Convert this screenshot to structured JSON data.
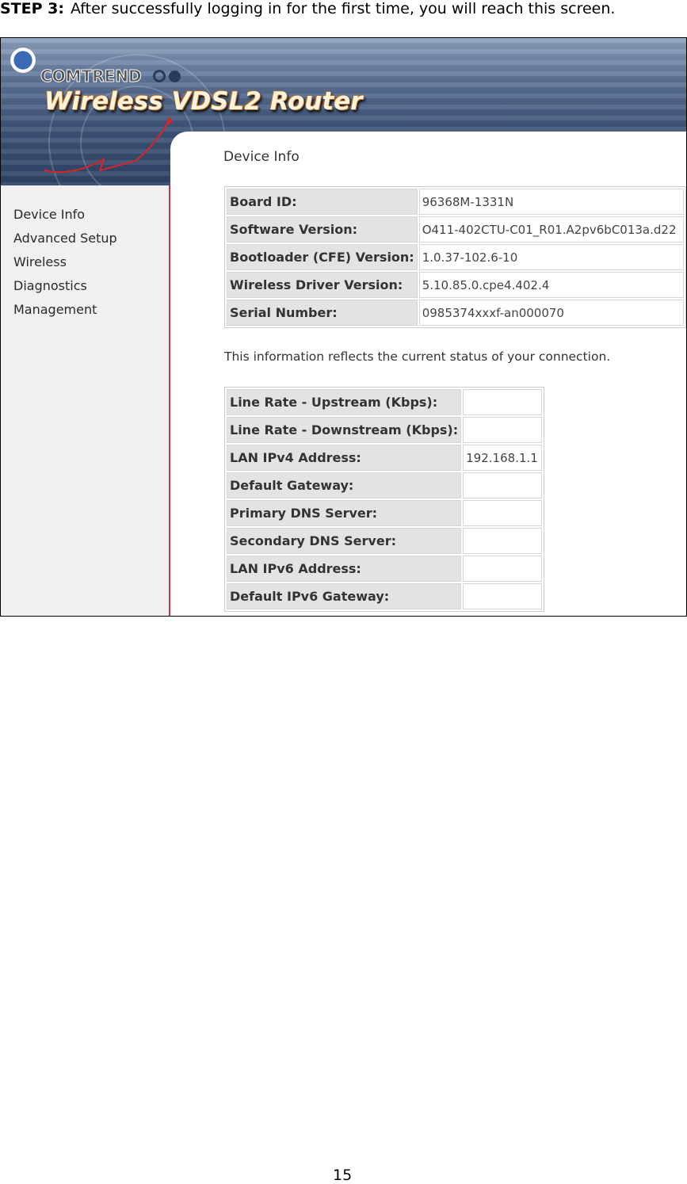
{
  "step": {
    "label": "STEP 3:",
    "text": "After successfully logging in for the first time, you will reach this screen."
  },
  "banner": {
    "brand": "COMTREND",
    "product": "Wireless VDSL2 Router"
  },
  "sidebar": {
    "items": [
      {
        "label": "Device Info"
      },
      {
        "label": "Advanced Setup"
      },
      {
        "label": "Wireless"
      },
      {
        "label": "Diagnostics"
      },
      {
        "label": "Management"
      }
    ]
  },
  "main": {
    "title": "Device Info",
    "info_table": [
      {
        "label": "Board ID:",
        "value": "96368M-1331N"
      },
      {
        "label": "Software Version:",
        "value": "O411-402CTU-C01_R01.A2pv6bC013a.d22"
      },
      {
        "label": "Bootloader (CFE) Version:",
        "value": "1.0.37-102.6-10"
      },
      {
        "label": "Wireless Driver Version:",
        "value": "5.10.85.0.cpe4.402.4"
      },
      {
        "label": "Serial Number:",
        "value": "0985374xxxf-an000070"
      }
    ],
    "note": "This information reflects the current status of your connection.",
    "status_table": [
      {
        "label": "Line Rate - Upstream (Kbps):",
        "value": ""
      },
      {
        "label": "Line Rate - Downstream (Kbps):",
        "value": ""
      },
      {
        "label": "LAN IPv4 Address:",
        "value": "192.168.1.1"
      },
      {
        "label": "Default Gateway:",
        "value": ""
      },
      {
        "label": "Primary DNS Server:",
        "value": ""
      },
      {
        "label": "Secondary DNS Server:",
        "value": ""
      },
      {
        "label": "LAN IPv6 Address:",
        "value": ""
      },
      {
        "label": "Default IPv6 Gateway:",
        "value": ""
      }
    ]
  },
  "page_number": "15"
}
